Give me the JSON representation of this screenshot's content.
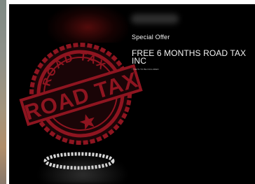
{
  "offer": {
    "eyebrow": "Special Offer",
    "title": "FREE 6 MONTHS ROAD TAX INC",
    "fineprint": "* T&C'S TO BE INCLUDED"
  },
  "stamp": {
    "text_top": "ROAD TAX",
    "text_main": "ROAD TAX",
    "color": "#8e1520"
  },
  "colors": {
    "background": "#000000",
    "text": "#f2f2f2"
  }
}
